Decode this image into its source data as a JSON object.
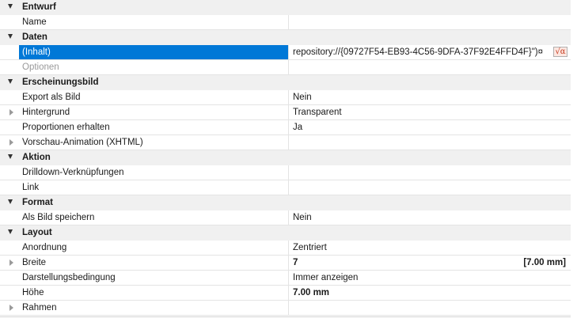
{
  "sections": [
    {
      "label": "Entwurf",
      "props": [
        {
          "name": "Name",
          "value": ""
        }
      ]
    },
    {
      "label": "Daten",
      "props": [
        {
          "name": "(Inhalt)",
          "value": "repository://{09727F54-EB93-4C56-9DFA-37F92E4FFD4F}\")¤",
          "selected": true,
          "fx": "√α"
        },
        {
          "name": "Optionen",
          "value": "",
          "disabled": true
        }
      ]
    },
    {
      "label": "Erscheinungsbild",
      "props": [
        {
          "name": "Export als Bild",
          "value": "Nein"
        },
        {
          "name": "Hintergrund",
          "value": "Transparent",
          "expandable": true
        },
        {
          "name": "Proportionen erhalten",
          "value": "Ja"
        },
        {
          "name": "Vorschau-Animation (XHTML)",
          "value": "",
          "expandable": true
        }
      ]
    },
    {
      "label": "Aktion",
      "props": [
        {
          "name": "Drilldown-Verknüpfungen",
          "value": ""
        },
        {
          "name": "Link",
          "value": ""
        }
      ]
    },
    {
      "label": "Format",
      "props": [
        {
          "name": "Als Bild speichern",
          "value": "Nein"
        }
      ]
    },
    {
      "label": "Layout",
      "props": [
        {
          "name": "Anordnung",
          "value": "Zentriert"
        },
        {
          "name": "Breite",
          "value": "7",
          "bold": true,
          "expandable": true,
          "unit": "[7.00 mm]"
        },
        {
          "name": "Darstellungsbedingung",
          "value": "Immer anzeigen"
        },
        {
          "name": "Höhe",
          "value": "7.00 mm",
          "bold": true
        },
        {
          "name": "Rahmen",
          "value": "",
          "expandable": true
        }
      ]
    }
  ]
}
